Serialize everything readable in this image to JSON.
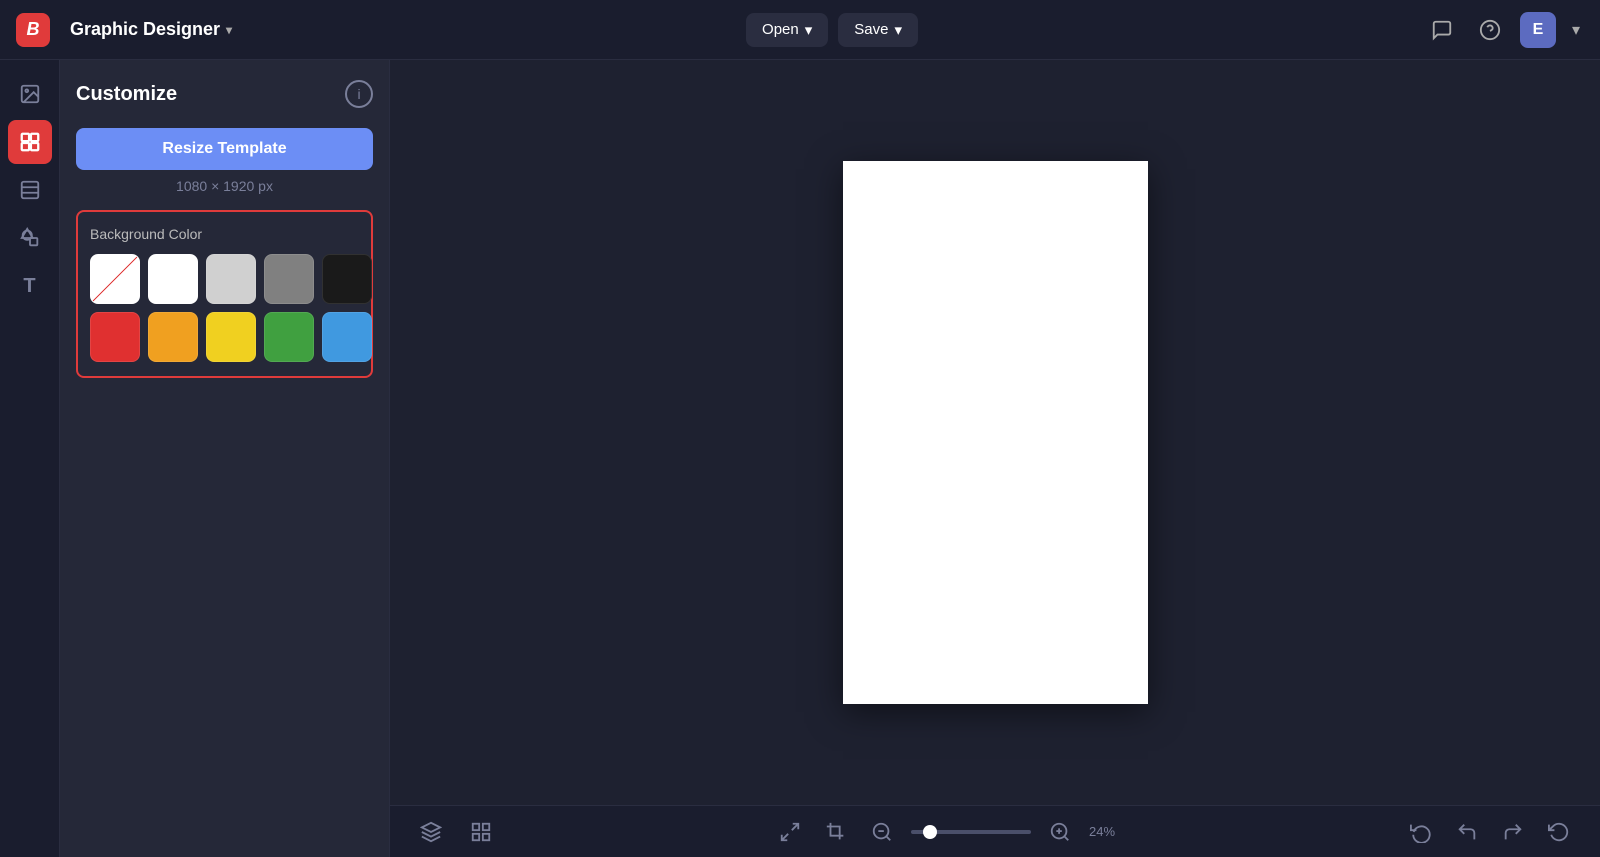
{
  "app": {
    "logo": "B",
    "logo_bg": "#e03b3b"
  },
  "topbar": {
    "project_name": "Graphic Designer",
    "open_label": "Open",
    "save_label": "Save",
    "user_initial": "E"
  },
  "sidebar": {
    "items": [
      {
        "id": "image",
        "icon": "🖼",
        "label": "Image",
        "active": false
      },
      {
        "id": "customize",
        "icon": "⊞",
        "label": "Customize",
        "active": true
      },
      {
        "id": "layout",
        "icon": "▦",
        "label": "Layout",
        "active": false
      },
      {
        "id": "elements",
        "icon": "❖",
        "label": "Elements",
        "active": false
      },
      {
        "id": "text",
        "icon": "T",
        "label": "Text",
        "active": false
      }
    ]
  },
  "customize_panel": {
    "title": "Customize",
    "info_label": "i",
    "resize_btn_label": "Resize Template",
    "template_size": "1080 × 1920 px",
    "bg_color_section": {
      "label": "Background Color",
      "colors": [
        {
          "id": "transparent",
          "value": "transparent",
          "label": "Transparent"
        },
        {
          "id": "white",
          "value": "#ffffff",
          "label": "White"
        },
        {
          "id": "light-gray",
          "value": "#d0d0d0",
          "label": "Light Gray"
        },
        {
          "id": "gray",
          "value": "#808080",
          "label": "Gray"
        },
        {
          "id": "black",
          "value": "#1a1a1a",
          "label": "Black"
        },
        {
          "id": "red",
          "value": "#e03030",
          "label": "Red"
        },
        {
          "id": "orange",
          "value": "#f0a020",
          "label": "Orange"
        },
        {
          "id": "yellow",
          "value": "#f0d020",
          "label": "Yellow"
        },
        {
          "id": "green",
          "value": "#40a040",
          "label": "Green"
        },
        {
          "id": "blue",
          "value": "#4099e0",
          "label": "Blue"
        }
      ]
    }
  },
  "canvas": {
    "bg_color": "#ffffff"
  },
  "bottombar": {
    "zoom_pct": "24%",
    "zoom_value": 24
  }
}
